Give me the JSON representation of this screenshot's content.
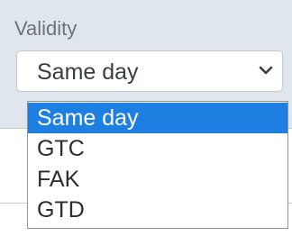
{
  "validity": {
    "label": "Validity",
    "selected_value": "Same day",
    "chevron_icon": "chevron-down-icon",
    "options": [
      {
        "label": "Same day",
        "selected": true
      },
      {
        "label": "GTC",
        "selected": false
      },
      {
        "label": "FAK",
        "selected": false
      },
      {
        "label": "GTD",
        "selected": false
      }
    ]
  },
  "colors": {
    "panel_background": "#dfe6ed",
    "selected_option_background": "#1e7fe3",
    "selected_option_text": "#ffffff",
    "label_text": "#6f7378"
  }
}
